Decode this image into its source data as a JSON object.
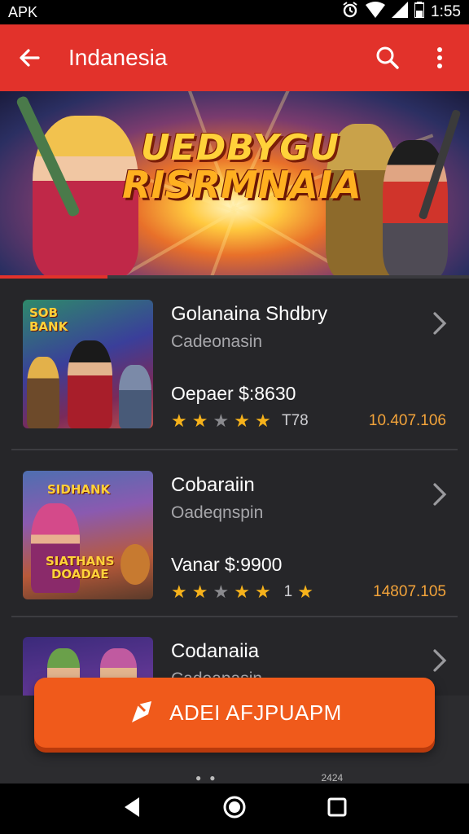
{
  "status": {
    "left": "APK",
    "time": "1:55"
  },
  "appbar": {
    "title": "Indanesia"
  },
  "banner": {
    "line1": "UEDBYGU",
    "line2": "RISRMNAIA",
    "progress": 0.23
  },
  "items": [
    {
      "name": "Golanaina Shdbry",
      "sub": "Cadeonasin",
      "price": "Oepaer $:8630",
      "stars": [
        1,
        1,
        0,
        1,
        1
      ],
      "count": "T78",
      "downloads": "10.407.106",
      "thumb_text": [
        "SOB",
        "BANK"
      ]
    },
    {
      "name": "Cobaraiin",
      "sub": "Oadeqnspin",
      "price": "Vanar $:9900",
      "stars": [
        1,
        1,
        0,
        1,
        1
      ],
      "count": "1",
      "downloads": "14807.105",
      "thumb_text": [
        "SIDHANK",
        "SIATHANS",
        "DOADAE"
      ]
    },
    {
      "name": "Codanaiia",
      "sub": "Cadeapasin"
    }
  ],
  "cta": {
    "label": "ADEI AFJPUAPM"
  },
  "footstrip": {
    "text": "2424"
  },
  "colors": {
    "appbar": "#e2322b",
    "cta": "#f05a1b",
    "star": "#f6b21b",
    "downloads": "#f2a33a"
  }
}
